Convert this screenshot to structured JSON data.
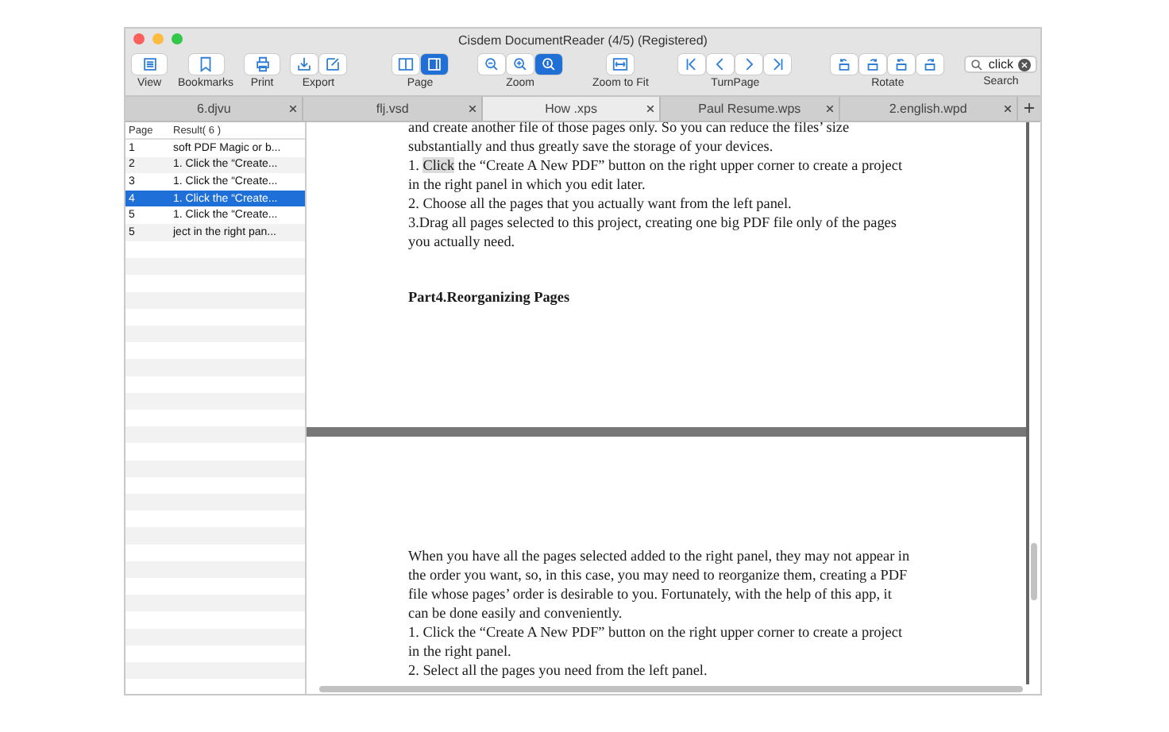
{
  "window": {
    "title": "Cisdem DocumentReader (4/5) (Registered)"
  },
  "toolbar": [
    {
      "label": "View"
    },
    {
      "label": "Bookmarks"
    },
    {
      "label": "Print"
    },
    {
      "label": "Export"
    },
    {
      "label": "Page",
      "buttons": [
        {
          "selected": false
        },
        {
          "selected": true
        }
      ]
    },
    {
      "label": "Zoom",
      "buttons": [
        {
          "selected": false
        },
        {
          "selected": false
        },
        {
          "selected": true
        }
      ]
    },
    {
      "label": "Zoom to Fit"
    },
    {
      "label": "TurnPage"
    },
    {
      "label": "Rotate"
    }
  ],
  "search": {
    "label": "Search",
    "value": "click"
  },
  "tabs": [
    {
      "label": "6.djvu",
      "selected": false
    },
    {
      "label": "flj.vsd",
      "selected": false
    },
    {
      "label": "How .xps",
      "selected": true
    },
    {
      "label": "Paul Resume.wps",
      "selected": false
    },
    {
      "label": "2.english.wpd",
      "selected": false
    }
  ],
  "results": {
    "columns": [
      "Page",
      "Result( 6 )"
    ],
    "rows": [
      {
        "page": "1",
        "result": "soft PDF Magic or b...",
        "selected": false
      },
      {
        "page": "2",
        "result": "1. Click the “Create...",
        "selected": false
      },
      {
        "page": "3",
        "result": "1. Click the “Create...",
        "selected": false
      },
      {
        "page": "4",
        "result": "1. Click the “Create...",
        "selected": true
      },
      {
        "page": "5",
        "result": "1. Click the “Create...",
        "selected": false
      },
      {
        "page": "5",
        "result": "ject in the right pan...",
        "selected": false
      }
    ]
  },
  "pages": [
    {
      "blocks": [
        {
          "kind": "line",
          "segments": [
            {
              "text": "and create another file of those pages only. So you can reduce the files’ size"
            }
          ]
        },
        {
          "kind": "line",
          "segments": [
            {
              "text": "substantially and thus greatly save the storage of your devices."
            }
          ]
        },
        {
          "kind": "line",
          "segments": [
            {
              "text": "1. "
            },
            {
              "text": "Click",
              "highlighted": true
            },
            {
              "text": " the “Create A New PDF” button on the right upper corner to create a project"
            }
          ]
        },
        {
          "kind": "line",
          "segments": [
            {
              "text": "in the right panel in which you edit later."
            }
          ]
        },
        {
          "kind": "line",
          "segments": [
            {
              "text": "2. Choose all the pages that you actually want from the left panel."
            }
          ]
        },
        {
          "kind": "line",
          "segments": [
            {
              "text": "3.Drag all pages selected to this project, creating one big PDF file only of the pages"
            }
          ]
        },
        {
          "kind": "line",
          "segments": [
            {
              "text": "you actually need."
            }
          ]
        },
        {
          "kind": "heading",
          "segments": [
            {
              "text": "Part4.Reorganizing Pages"
            }
          ]
        }
      ]
    },
    {
      "blocks": [
        {
          "kind": "line",
          "segments": [
            {
              "text": "When you have all the pages selected added to the right panel, they may not appear in"
            }
          ]
        },
        {
          "kind": "line",
          "segments": [
            {
              "text": "the order you want, so, in this case, you may need to reorganize them, creating a PDF"
            }
          ]
        },
        {
          "kind": "line",
          "segments": [
            {
              "text": "file whose pages’ order is desirable to you. Fortunately, with the help of this app, it"
            }
          ]
        },
        {
          "kind": "line",
          "segments": [
            {
              "text": "can be done easily and conveniently."
            }
          ]
        },
        {
          "kind": "line",
          "segments": [
            {
              "text": "1. Click the “Create A New PDF” button on the right upper corner to create a project"
            }
          ]
        },
        {
          "kind": "line",
          "segments": [
            {
              "text": "in the right panel."
            }
          ]
        },
        {
          "kind": "line",
          "segments": [
            {
              "text": "2. Select all the pages you need from the left panel."
            }
          ]
        }
      ]
    }
  ]
}
